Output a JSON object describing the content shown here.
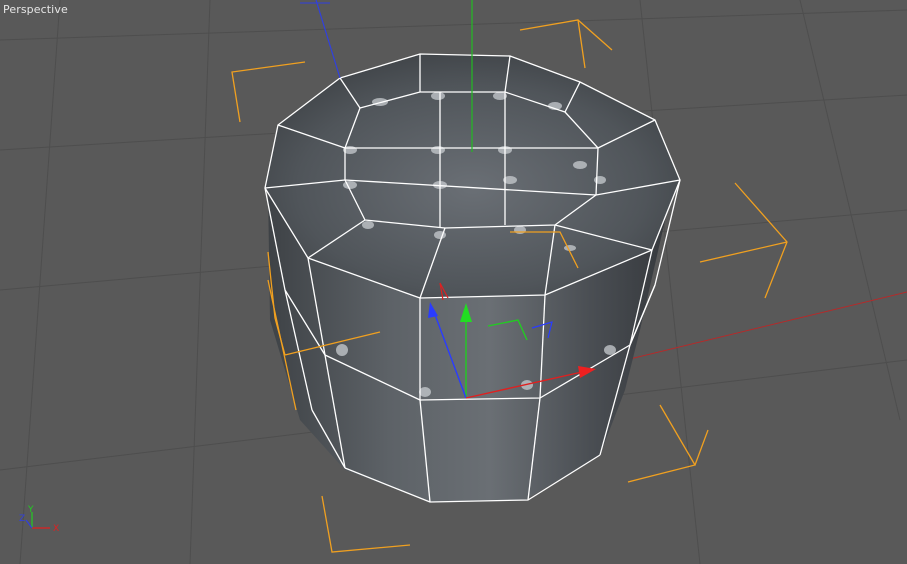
{
  "viewport": {
    "label": "Perspective",
    "background": "#595959",
    "grid_color": "#4d4d4d"
  },
  "scene": {
    "object": "tufted-ottoman-mesh",
    "body_color": "#4f5358",
    "cage_color": "#ffffff",
    "selection_bracket_color": "#f5a623"
  },
  "axis_colors": {
    "x": "#e02020",
    "y": "#22cc22",
    "z": "#2a3cff"
  },
  "orientation_gizmo": {
    "x_label": "X",
    "y_label": "Y",
    "z_label": "Z"
  }
}
